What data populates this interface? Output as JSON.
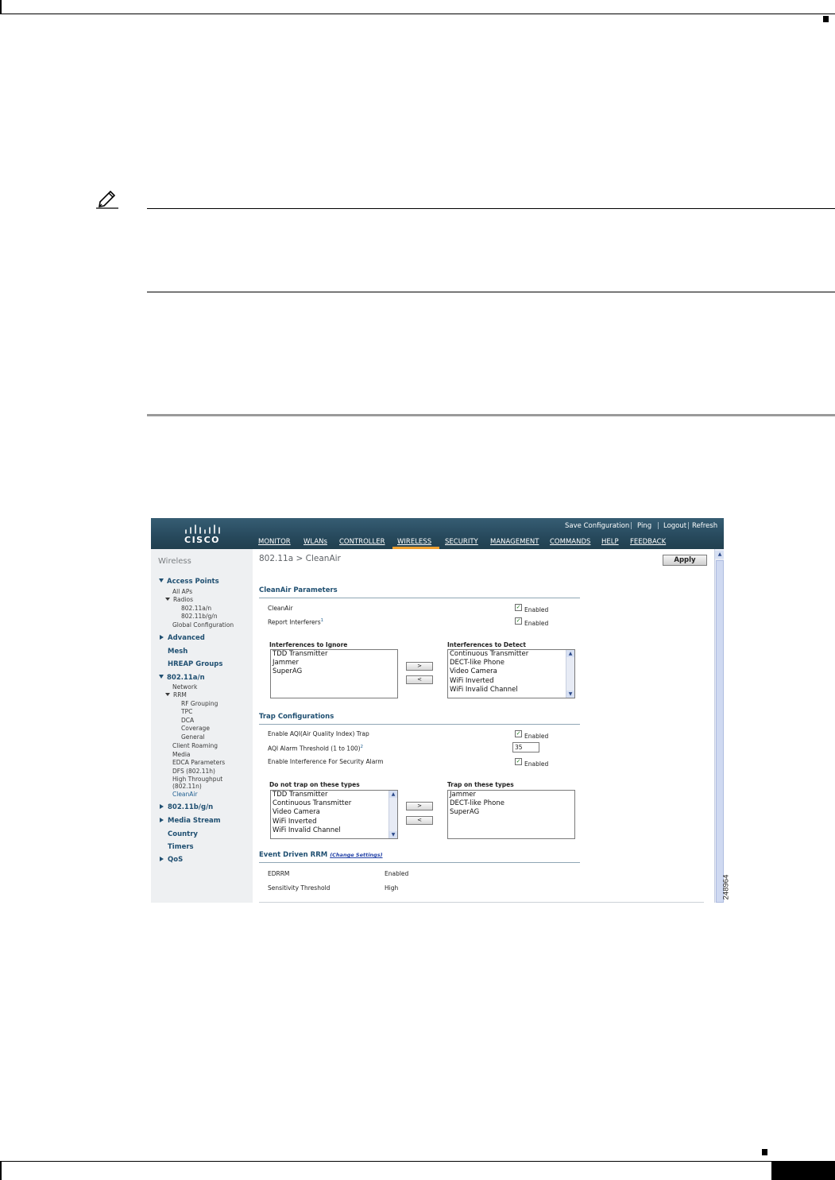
{
  "figure_id": "248964",
  "ui": {
    "logo_text": "CISCO",
    "top_links": [
      "Save Configuration",
      "Ping",
      "Logout",
      "Refresh"
    ],
    "menu": [
      "MONITOR",
      "WLANs",
      "CONTROLLER",
      "WIRELESS",
      "SECURITY",
      "MANAGEMENT",
      "COMMANDS",
      "HELP",
      "FEEDBACK"
    ],
    "active_menu": "WIRELESS",
    "nav": {
      "title": "Wireless",
      "access_points": "Access Points",
      "all_aps": "All APs",
      "radios": "Radios",
      "radio_a": "802.11a/n",
      "radio_bg": "802.11b/g/n",
      "global_config": "Global Configuration",
      "advanced": "Advanced",
      "mesh": "Mesh",
      "hreap": "HREAP Groups",
      "a_n": "802.11a/n",
      "network": "Network",
      "rrm": "RRM",
      "rf_grouping": "RF Grouping",
      "tpc": "TPC",
      "dca": "DCA",
      "coverage": "Coverage",
      "general": "General",
      "client_roaming": "Client Roaming",
      "media": "Media",
      "edca": "EDCA Parameters",
      "dfs": "DFS (802.11h)",
      "high_throughput": "High Throughput",
      "high_throughput_2": "(802.11n)",
      "cleanair": "CleanAir",
      "b_g_n": "802.11b/g/n",
      "media_stream": "Media Stream",
      "country": "Country",
      "timers": "Timers",
      "qos": "QoS"
    },
    "breadcrumb": "802.11a > CleanAir",
    "apply_label": "Apply",
    "cleanair_params": {
      "heading": "CleanAir Parameters",
      "cleanair_label": "CleanAir",
      "report_label": "Report Interferers",
      "report_note": "1",
      "enabled": "Enabled",
      "ignore_heading": "Interferences to Ignore",
      "detect_heading": "Interferences to Detect",
      "ignore_list": [
        "TDD Transmitter",
        "Jammer",
        "SuperAG"
      ],
      "detect_list": [
        "Continuous Transmitter",
        "DECT-like Phone",
        "Video Camera",
        "WiFi Inverted",
        "WiFi Invalid Channel"
      ],
      "move_right": ">",
      "move_left": "<"
    },
    "trap_config": {
      "heading": "Trap Configurations",
      "aqi_trap_label": "Enable AQI(Air Quality Index) Trap",
      "aqi_threshold_label": "AQI Alarm Threshold (1 to 100)",
      "aqi_threshold_note": "2",
      "aqi_threshold_value": "35",
      "security_alarm_label": "Enable Interference For Security Alarm",
      "enabled": "Enabled",
      "no_trap_heading": "Do not trap on these types",
      "trap_heading": "Trap on these types",
      "no_trap_list": [
        "TDD Transmitter",
        "Continuous Transmitter",
        "Video Camera",
        "WiFi Inverted",
        "WiFi Invalid Channel"
      ],
      "trap_list": [
        "Jammer",
        "DECT-like Phone",
        "SuperAG"
      ],
      "move_right": ">",
      "move_left": "<"
    },
    "edrrm": {
      "heading": "Event Driven RRM",
      "change_link": "(Change Settings)",
      "edrrm_label": "EDRRM",
      "edrrm_value": "Enabled",
      "sensitivity_label": "Sensitivity Threshold",
      "sensitivity_value": "High"
    }
  },
  "colors": {
    "header": "#27495c",
    "active_menu_bar": "#f0a030",
    "section_heading": "#1f4f71",
    "nav_bg": "#eef0f2"
  }
}
